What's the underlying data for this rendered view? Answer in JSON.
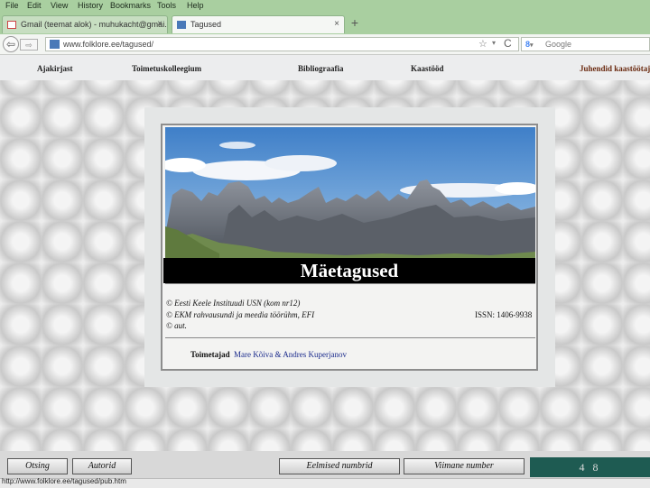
{
  "browser": {
    "menu": [
      "File",
      "Edit",
      "View",
      "History",
      "Bookmarks",
      "Tools",
      "Help"
    ],
    "tabs": [
      {
        "label": "Gmail (teemat alok) - muhukacht@gmai...",
        "active": false
      },
      {
        "label": "Tagused",
        "active": true
      }
    ],
    "new_tab_label": "+",
    "tab_close": "×",
    "url": "www.folklore.ee/tagused/",
    "search_engine": "Google",
    "search_logo": "8",
    "search_placeholder": "Google",
    "back_glyph": "⇦",
    "forward_glyph": "⇨",
    "star_glyph": "☆",
    "dropdown_glyph": "▾",
    "reload_glyph": "C",
    "status_url": "http://www.folklore.ee/tagused/pub.htm"
  },
  "site_nav": [
    "Ajakirjast",
    "Toimetuskolleegium",
    "Bibliograafia",
    "Kaastööd",
    "Juhendid kaastöötajatele"
  ],
  "journal": {
    "title": "Mäetagused",
    "info_lines": [
      "© Eesti Keele Instituudi USN (kom nr12)",
      "© EKM rahvausundi ja meedia töörühm, EFI",
      "© aut."
    ],
    "issn": "ISSN: 1406-9938",
    "editors_label": "Toimetajad",
    "editors_names": "Mare Kõiva & Andres Kuperjanov"
  },
  "bottom_nav": [
    "Otsing",
    "Autorid",
    "Eelmised numbrid",
    "Viimane number"
  ],
  "page_number": "4 8",
  "colors": {
    "chrome": "#a9cfa0",
    "page_counter_bg": "#1e5b52",
    "title_bar": "#000000",
    "editor_names": "#1b2b8c"
  }
}
